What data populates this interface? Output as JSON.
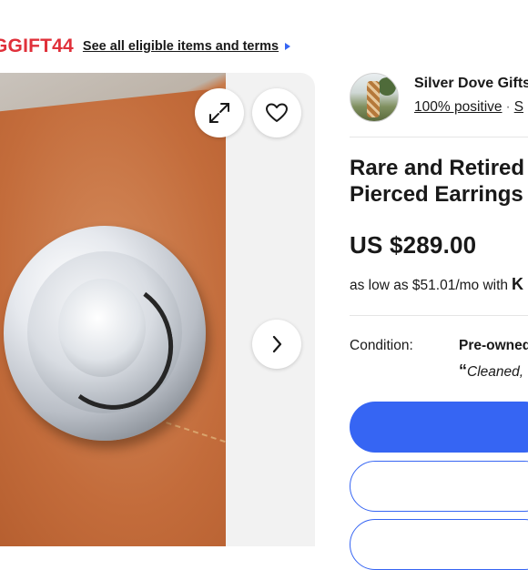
{
  "promo": {
    "code": "GGIFT44",
    "link_label": "See all eligible items and terms"
  },
  "gallery": {
    "expand_icon": "expand-icon",
    "watch_icon": "heart-icon",
    "next_icon": "chevron-right-icon"
  },
  "seller": {
    "name": "Silver Dove Gifts",
    "feedback": "100% positive",
    "separator": "·",
    "more_link": "S"
  },
  "item": {
    "title_line1": "Rare and Retired",
    "title_line2": "Pierced Earrings",
    "price": "US $289.00",
    "financing_text": "as low as $51.01/mo with",
    "financing_brand": "K"
  },
  "condition": {
    "label": "Condition:",
    "value": "Pre-owned",
    "note_quote": "“",
    "note": "Cleaned,"
  },
  "colors": {
    "accent": "#3665f3",
    "promo_red": "#e0303a"
  }
}
